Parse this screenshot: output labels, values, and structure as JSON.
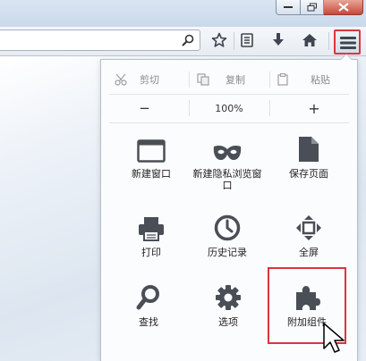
{
  "window": {
    "minimize_icon": "minimize-icon",
    "maximize_icon": "restore-icon",
    "close_icon": "close-icon"
  },
  "toolbar": {
    "url_value": "",
    "icons": [
      "search-icon",
      "bookmark-star-icon",
      "bookmarks-menu-icon",
      "download-icon",
      "home-icon",
      "hamburger-menu-icon"
    ]
  },
  "menu": {
    "edit": {
      "cut": "剪切",
      "copy": "复制",
      "paste": "粘贴"
    },
    "zoom": {
      "minus": "−",
      "level": "100%",
      "plus": "+"
    },
    "items": [
      {
        "label": "新建窗口",
        "icon": "new-window-icon"
      },
      {
        "label": "新建隐私浏览窗口",
        "icon": "private-mask-icon"
      },
      {
        "label": "保存页面",
        "icon": "save-page-icon"
      },
      {
        "label": "打印",
        "icon": "printer-icon"
      },
      {
        "label": "历史记录",
        "icon": "history-clock-icon"
      },
      {
        "label": "全屏",
        "icon": "fullscreen-icon"
      },
      {
        "label": "查找",
        "icon": "find-magnifier-icon"
      },
      {
        "label": "选项",
        "icon": "options-gear-icon"
      },
      {
        "label": "附加组件",
        "icon": "addons-puzzle-icon"
      }
    ]
  },
  "colors": {
    "highlight": "#d9363e",
    "icon": "#4a4f57",
    "panel": "#fbfcfd"
  }
}
